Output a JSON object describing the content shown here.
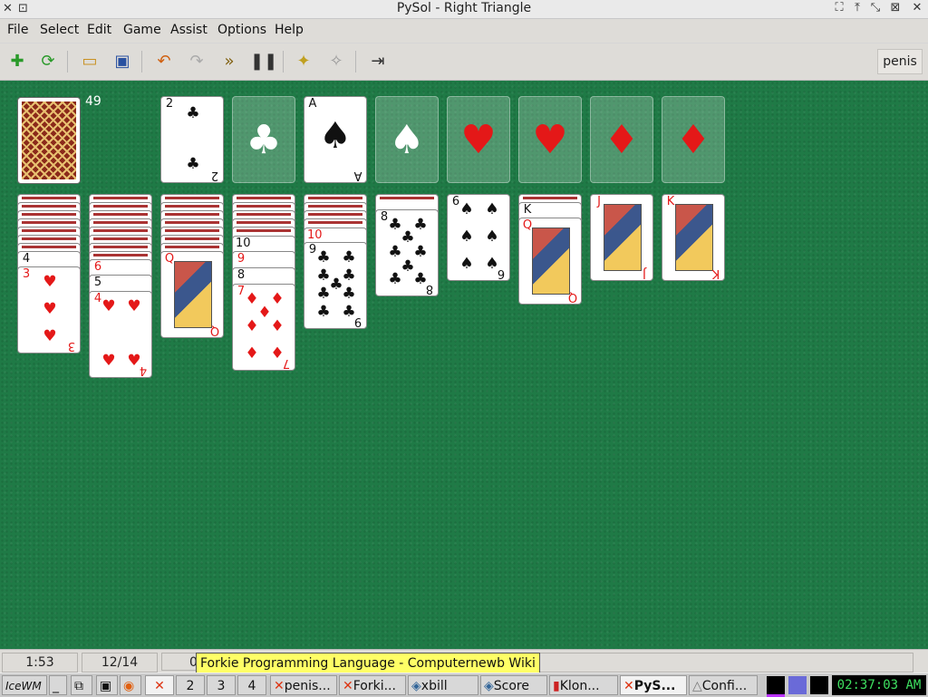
{
  "window": {
    "title": "PySol - Right Triangle"
  },
  "menu": [
    "File",
    "Select",
    "Edit",
    "Game",
    "Assist",
    "Options",
    "Help"
  ],
  "toolbar": {
    "buttons": [
      "new-game-icon",
      "restart-icon",
      "open-icon",
      "save-icon",
      "undo-icon",
      "redo-icon",
      "autodrop-icon",
      "pause-icon",
      "rules-icon",
      "statistics-icon",
      "quit-icon"
    ],
    "player": "penis"
  },
  "stock": {
    "count": "49"
  },
  "top_row": [
    {
      "type": "card",
      "rank": "2",
      "suit": "♣",
      "color": "black"
    },
    {
      "type": "slot",
      "suit": "♣"
    },
    {
      "type": "card",
      "rank": "A",
      "suit": "♠",
      "color": "black"
    },
    {
      "type": "slot",
      "suit": "♠"
    },
    {
      "type": "slot",
      "suit": "♥",
      "color": "red"
    },
    {
      "type": "slot",
      "suit": "♥",
      "color": "red"
    },
    {
      "type": "slot",
      "suit": "♦",
      "color": "red"
    },
    {
      "type": "slot",
      "suit": "♦",
      "color": "red"
    }
  ],
  "tableau": {
    "col1": {
      "top": {
        "rank": "3",
        "suit": "♥"
      },
      "peek": {
        "rank": "4",
        "suit": "♠"
      }
    },
    "col2": {
      "top": {
        "rank": "4",
        "suit": "♥"
      },
      "peek1": {
        "rank": "6",
        "suit": "♥"
      },
      "peek2": {
        "rank": "5",
        "suit": "♠"
      }
    },
    "col3": {
      "top": {
        "rank": "Q",
        "suit": "♥"
      }
    },
    "col4": {
      "top": {
        "rank": "7",
        "suit": "♦"
      },
      "peek1": {
        "rank": "10",
        "suit": "♠"
      },
      "peek2": {
        "rank": "9",
        "suit": "♥"
      },
      "peek3": {
        "rank": "8",
        "suit": "♠"
      }
    },
    "col5": {
      "top": {
        "rank": "9",
        "suit": "♣"
      },
      "peek": {
        "rank": "10",
        "suit": "♦"
      }
    },
    "col6": {
      "top": {
        "rank": "8",
        "suit": "♣"
      }
    },
    "col7": {
      "top": {
        "rank": "6",
        "suit": "♠"
      }
    },
    "col8": {
      "top": {
        "rank": "Q",
        "suit": "♥"
      },
      "peek": {
        "rank": "K",
        "suit": "♠"
      }
    },
    "col9": {
      "top": {
        "rank": "J",
        "suit": "♦"
      }
    },
    "col10": {
      "top": {
        "rank": "K",
        "suit": "♥"
      }
    }
  },
  "status": {
    "time": "1:53",
    "moves": "12/14",
    "third": "0",
    "tooltip": "Forkie Programming Language - Computernewb Wiki"
  },
  "taskbar": {
    "workspaces": [
      "2",
      "3",
      "4"
    ],
    "tasks": [
      "penis...",
      "Forki...",
      "xbill",
      "Score",
      "Klon...",
      "PyS...",
      "Confi..."
    ],
    "clock": "02:37:03 AM"
  }
}
